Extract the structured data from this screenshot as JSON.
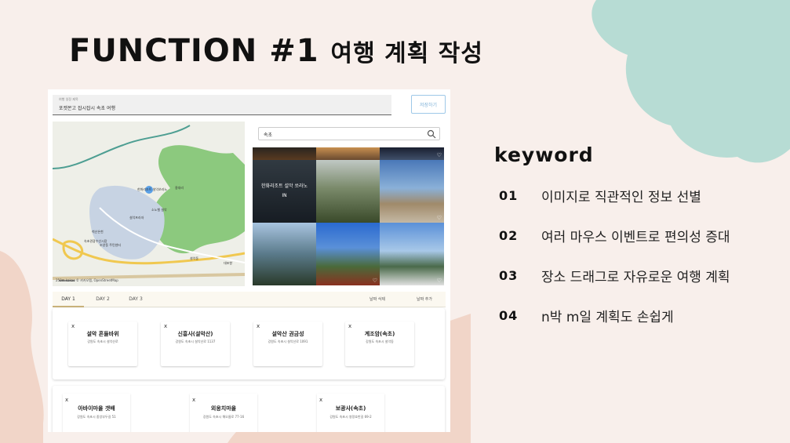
{
  "slide": {
    "title": "FUNCTION #1",
    "title_ko": "여행 계획 작성",
    "accent_color": "#b7dcd4",
    "blob_color": "#f1d5c8"
  },
  "app": {
    "header_label": "여행 일정 제목",
    "header_value": "포켓몬고 잡시잡시 속초 여행",
    "save_button": "저장하기",
    "search": {
      "value": "속초"
    },
    "map": {
      "labels": [
        "한화리조트 설악쏘라노",
        "용대리",
        "설악프라자",
        "소노벨 설악",
        "속초관광수산시장",
        "척산온천",
        "조양동 주민센터",
        "설악동",
        "대포항"
      ],
      "credit": "250m kakao © 카카오맵, OpenStreetMap"
    },
    "photo_overlay": {
      "title": "한화리조트 설악 쏘라노",
      "subtitle": "IN"
    },
    "tabs": [
      "DAY 1",
      "DAY 2",
      "DAY 3"
    ],
    "tab_actions": [
      "날짜 삭제",
      "날짜 추가"
    ],
    "day1_places": [
      {
        "name": "설악 흔들바위",
        "addr": "강원도 속초시 설악산로"
      },
      {
        "name": "신흥사(설악산)",
        "addr": "강원도 속초시 설악산로 1137"
      },
      {
        "name": "설악산 권금성",
        "addr": "강원도 속초시 설악산로 1091"
      },
      {
        "name": "계조암(속초)",
        "addr": "강원도 속초시 설악동"
      }
    ],
    "day2_places": [
      {
        "name": "아바이마을 갯배",
        "addr": "강원도 속초시 중앙부두길 51"
      },
      {
        "name": "외옹치마을",
        "addr": "강원도 속초시 해오름로 77-16"
      },
      {
        "name": "보광사(속초)",
        "addr": "강원도 속초시 영랑호반길 69-2"
      }
    ],
    "close_symbol": "x"
  },
  "keywords": {
    "title": "keyword",
    "items": [
      {
        "num": "01",
        "text": "이미지로 직관적인 정보 선별"
      },
      {
        "num": "02",
        "text": "여러 마우스 이벤트로 편의성 증대"
      },
      {
        "num": "03",
        "text": "장소 드래그로 자유로운 여행 계획"
      },
      {
        "num": "04",
        "text": "n박 m일 계획도 손쉽게"
      }
    ]
  }
}
